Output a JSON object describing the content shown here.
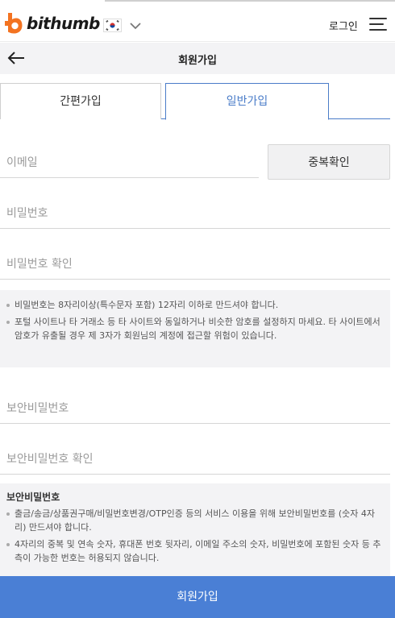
{
  "header": {
    "logo_text": "bithumb",
    "login_label": "로그인",
    "brand_color": "#f37321"
  },
  "titlebar": {
    "title": "회원가입"
  },
  "tabs": [
    {
      "label": "간편가입",
      "active": false
    },
    {
      "label": "일반가입",
      "active": true
    }
  ],
  "form": {
    "email_placeholder": "이메일",
    "dup_check_label": "중복확인",
    "password_placeholder": "비밀번호",
    "password_confirm_placeholder": "비밀번호 확인",
    "password_notice": [
      "비밀번호는 8자리이상(특수문자 포함) 12자리 이하로 만드셔야 합니다.",
      "포털 사이트나 타 거래소 등 타 사이트와 동일하거나 비슷한 암호를 설정하지 마세요. 타 사이트에서 암호가 유출될 경우 제 3자가 회원님의 계정에 접근할 위험이 있습니다."
    ],
    "security_pw_placeholder": "보안비밀번호",
    "security_pw_confirm_placeholder": "보안비밀번호 확인",
    "security_notice_heading": "보안비밀번호",
    "security_notice": [
      "출금/송금/상품권구매/비밀번호변경/OTP인증 등의 서비스 이용을 위해 보안비밀번호를 (숫자 4자리) 만드셔야 합니다.",
      "4자리의 중복 및 연속 숫자, 휴대폰 번호 뒷자리, 이메일 주소의 숫자, 비밀번호에 포함된 숫자 등 추측이 가능한 번호는 허용되지 않습니다."
    ]
  },
  "submit_label": "회원가입",
  "colors": {
    "accent": "#4a7cc8",
    "submit_bg": "#4a7fd5"
  }
}
